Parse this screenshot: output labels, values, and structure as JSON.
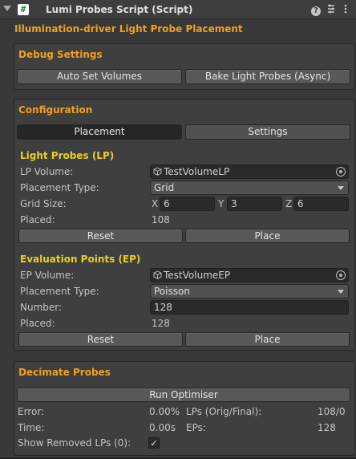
{
  "header": {
    "title": "Lumi Probes Script (Script)",
    "script_icon_glyph": "#",
    "icons": [
      "help-icon",
      "preset-icon",
      "context-menu-icon"
    ]
  },
  "main_title": "Illumination-driver Light Probe Placement",
  "debug": {
    "title": "Debug Settings",
    "auto_set_volumes": "Auto Set Volumes",
    "bake_light_probes": "Bake Light Probes (Async)"
  },
  "configuration": {
    "title": "Configuration",
    "tabs": [
      {
        "label": "Placement",
        "selected": true
      },
      {
        "label": "Settings",
        "selected": false
      }
    ]
  },
  "light_probes": {
    "title": "Light Probes (LP)",
    "volume_label": "LP Volume:",
    "volume_value": "TestVolumeLP",
    "placement_type_label": "Placement Type:",
    "placement_type_value": "Grid",
    "grid_size_label": "Grid Size:",
    "grid": {
      "x_label": "X",
      "x": "6",
      "y_label": "Y",
      "y": "3",
      "z_label": "Z",
      "z": "6"
    },
    "placed_label": "Placed:",
    "placed_value": "108",
    "reset": "Reset",
    "place": "Place"
  },
  "evaluation_points": {
    "title": "Evaluation Points (EP)",
    "volume_label": "EP Volume:",
    "volume_value": "TestVolumeEP",
    "placement_type_label": "Placement Type:",
    "placement_type_value": "Poisson",
    "number_label": "Number:",
    "number_value": "128",
    "placed_label": "Placed:",
    "placed_value": "128",
    "reset": "Reset",
    "place": "Place"
  },
  "decimate": {
    "title": "Decimate Probes",
    "run_optimiser": "Run Optimiser",
    "error_label": "Error:",
    "error_value": "0.00%",
    "lps_label": "LPs (Orig/Final):",
    "lps_value": "108/0",
    "time_label": "Time:",
    "time_value": "0.00s",
    "eps_label": "EPs:",
    "eps_value": "128",
    "show_removed_label": "Show Removed LPs (0):",
    "show_removed_checked": true,
    "check_glyph": "✓"
  },
  "colors": {
    "section_title": "#f0a020",
    "subsection_title": "#e8d020",
    "background": "#383838"
  }
}
